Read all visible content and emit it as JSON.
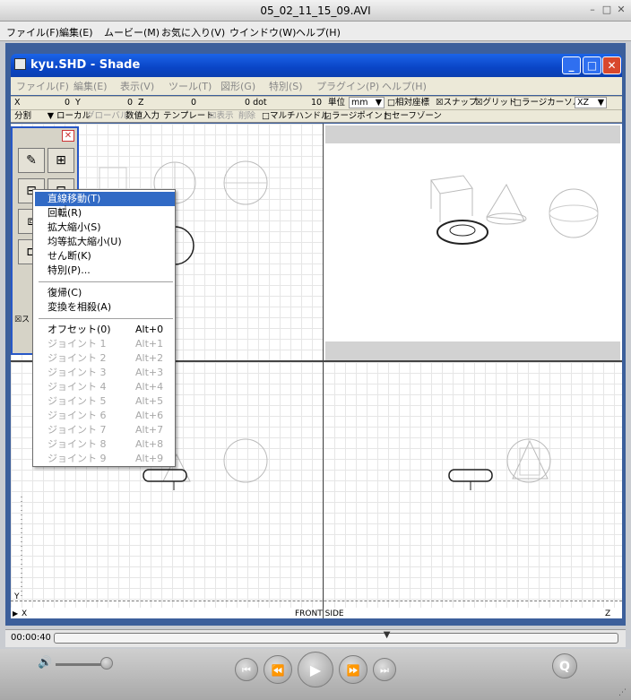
{
  "player": {
    "title": "05_02_11_15_09.AVI",
    "controls": {
      "min": "–",
      "max": "□",
      "close": "✕"
    },
    "menu": [
      "ファイル(F)",
      "編集(E)",
      "ムービー(M)",
      "お気に入り(V)",
      "ウインドウ(W)",
      "ヘルプ(H)"
    ],
    "timecode": "00:00:40",
    "playhead_fraction": 0.59,
    "volume_fraction": 0.95
  },
  "shade": {
    "title": "kyu.SHD - Shade",
    "menu": [
      "ファイル(F)",
      "編集(E)",
      "表示(V)",
      "ツール(T)",
      "図形(G)",
      "特別(S)",
      "プラグイン(P)",
      "ヘルプ(H)"
    ],
    "toolbar1": {
      "x_label": "X",
      "x_value": "0",
      "y_label": "Y",
      "y_value": "0",
      "z_label": "Z",
      "z_value": "0",
      "dot_label": "0 dot",
      "num": "10",
      "unit_label": "単位",
      "unit_value": "mm",
      "relative": "□相対座標",
      "snap": "☒スナップ",
      "grid": "☒グリッド",
      "large_cursor": "□ラージカーソル",
      "plane": "XZ"
    },
    "toolbar2": {
      "split": "分割",
      "local": "ローカル",
      "global": "グローバル",
      "numeric": "数値入力",
      "template": "テンプレート",
      "display": "☒表示",
      "delete": "削除",
      "multi_handle": "□マルチハンドル",
      "large_point": "□ラージポイント",
      "safe_zone": "□セーフゾーン"
    },
    "viewport_labels": {
      "x_axis": "X",
      "y_axis": "Y",
      "front_side": "FRONT SIDE",
      "z_axis": "Z"
    }
  },
  "palette": {
    "close": "✕",
    "side_label": "☒ス",
    "buttons": [
      "✎",
      "⊞",
      "⊟",
      "⊡",
      "⧈",
      "⊏"
    ]
  },
  "context_menu": {
    "group1": [
      "直線移動(T)",
      "回転(R)",
      "拡大縮小(S)",
      "均等拡大縮小(U)",
      "せん断(K)",
      "特別(P)..."
    ],
    "group2": [
      "復帰(C)",
      "変換を相殺(A)"
    ],
    "group3": [
      {
        "label": "オフセット(0)",
        "shortcut": "Alt+0",
        "enabled": true
      },
      {
        "label": "ジョイント 1",
        "shortcut": "Alt+1",
        "enabled": false
      },
      {
        "label": "ジョイント 2",
        "shortcut": "Alt+2",
        "enabled": false
      },
      {
        "label": "ジョイント 3",
        "shortcut": "Alt+3",
        "enabled": false
      },
      {
        "label": "ジョイント 4",
        "shortcut": "Alt+4",
        "enabled": false
      },
      {
        "label": "ジョイント 5",
        "shortcut": "Alt+5",
        "enabled": false
      },
      {
        "label": "ジョイント 6",
        "shortcut": "Alt+6",
        "enabled": false
      },
      {
        "label": "ジョイント 7",
        "shortcut": "Alt+7",
        "enabled": false
      },
      {
        "label": "ジョイント 8",
        "shortcut": "Alt+8",
        "enabled": false
      },
      {
        "label": "ジョイント 9",
        "shortcut": "Alt+9",
        "enabled": false
      }
    ]
  },
  "icons": {
    "volume": "🔊",
    "prev": "⏮",
    "rewind": "⏪",
    "play": "▶",
    "forward": "⏩",
    "next": "⏭",
    "qt": "Q"
  }
}
